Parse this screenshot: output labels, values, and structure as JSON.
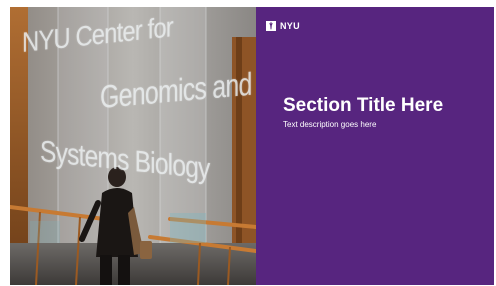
{
  "slide": {
    "photo": {
      "wall_lines": [
        "NYU Center for",
        "Genomics and",
        "Systems Biology"
      ],
      "description_icon": "photo-image"
    },
    "panel": {
      "background": "#57257f",
      "logo": {
        "text": "NYU",
        "icon": "torch-icon"
      },
      "title": "Section Title Here",
      "description": "Text description goes here"
    }
  }
}
